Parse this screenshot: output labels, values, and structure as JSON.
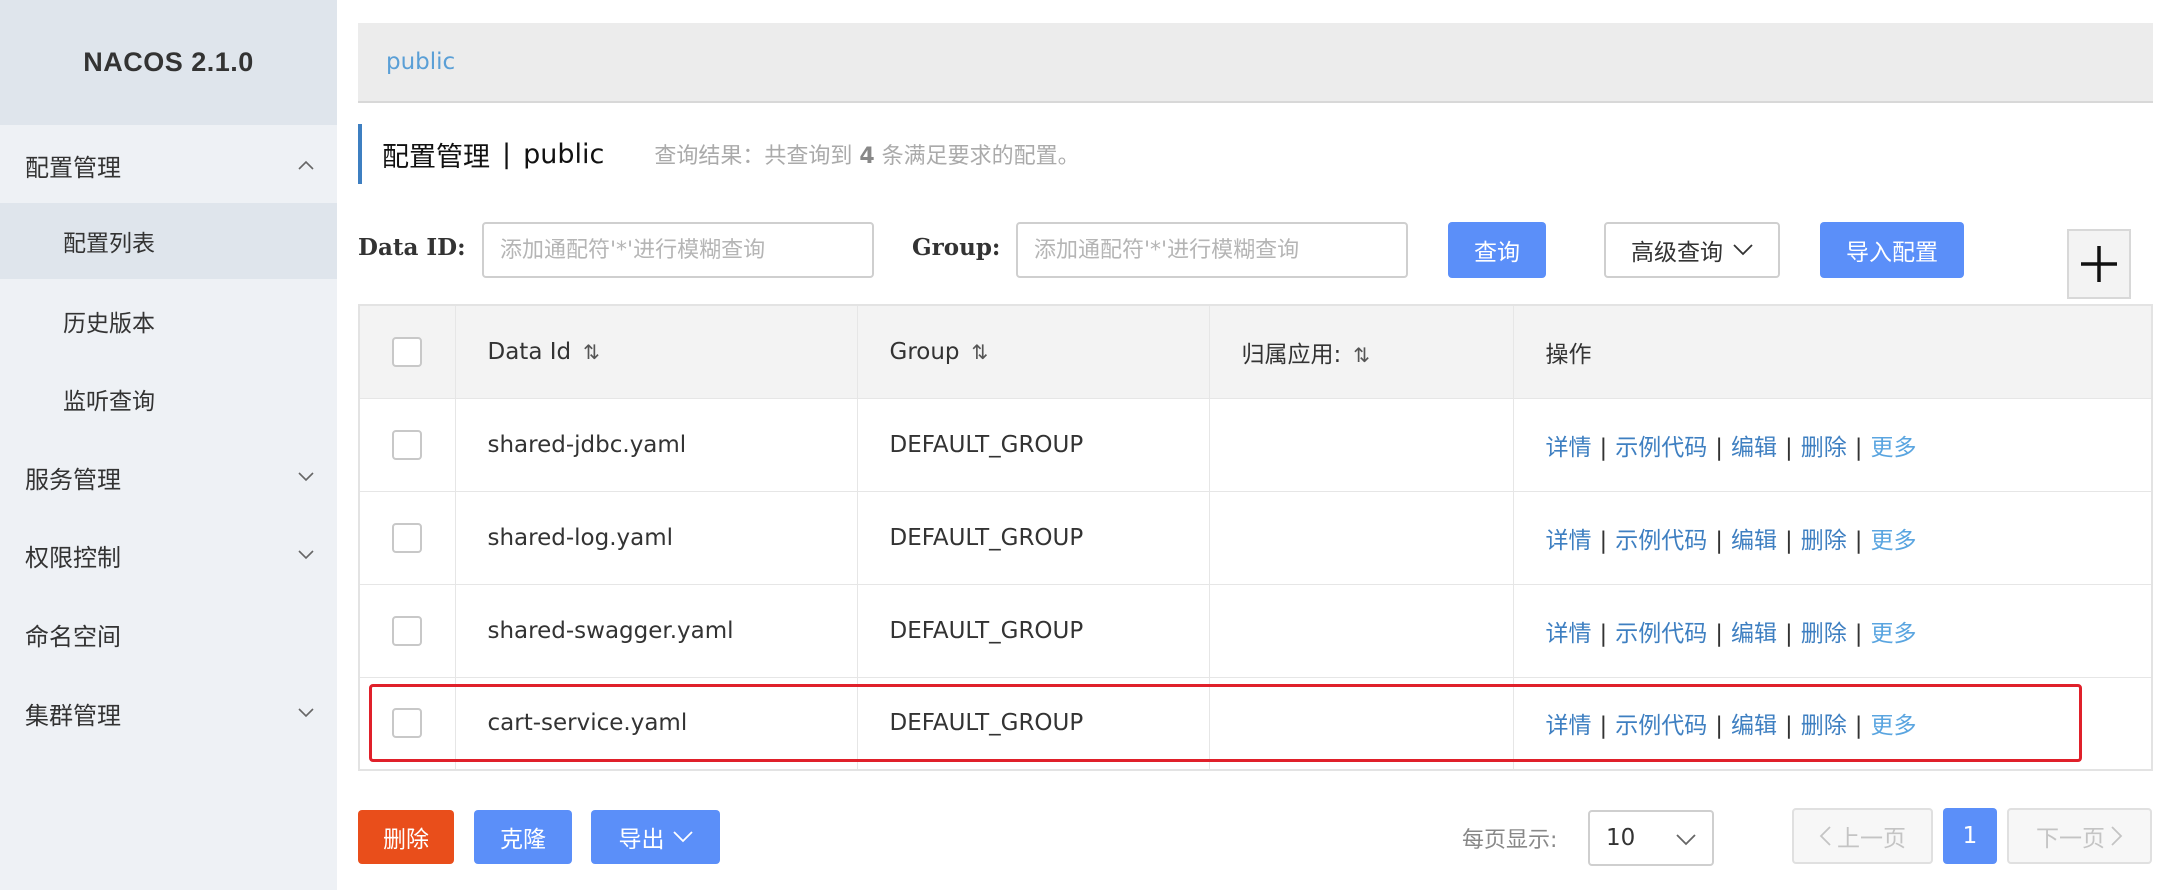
{
  "sidebar": {
    "brand": "NACOS 2.1.0",
    "config_mgmt": "配置管理",
    "sub_items": [
      "配置列表",
      "历史版本",
      "监听查询"
    ],
    "service_mgmt": "服务管理",
    "permission": "权限控制",
    "namespace": "命名空间",
    "cluster_mgmt": "集群管理"
  },
  "breadcrumb": {
    "namespace": "public"
  },
  "title": {
    "main": "配置管理",
    "separator": "|",
    "namespace": "public",
    "result_prefix": "查询结果：共查询到 ",
    "result_count": "4",
    "result_suffix": " 条满足要求的配置。"
  },
  "search": {
    "data_id_label": "Data ID:",
    "data_id_placeholder": "添加通配符'*'进行模糊查询",
    "group_label": "Group:",
    "group_placeholder": "添加通配符'*'进行模糊查询",
    "query_button": "查询",
    "advanced_button": "高级查询",
    "import_button": "导入配置"
  },
  "table": {
    "headers": {
      "data_id": "Data Id",
      "group": "Group",
      "app": "归属应用:",
      "ops": "操作"
    },
    "ops": {
      "detail": "详情",
      "sample": "示例代码",
      "edit": "编辑",
      "delete": "删除",
      "more": "更多",
      "sep": "|"
    },
    "rows": [
      {
        "data_id": "shared-jdbc.yaml",
        "group": "DEFAULT_GROUP",
        "app": ""
      },
      {
        "data_id": "shared-log.yaml",
        "group": "DEFAULT_GROUP",
        "app": ""
      },
      {
        "data_id": "shared-swagger.yaml",
        "group": "DEFAULT_GROUP",
        "app": ""
      },
      {
        "data_id": "cart-service.yaml",
        "group": "DEFAULT_GROUP",
        "app": ""
      }
    ]
  },
  "footer": {
    "delete_button": "删除",
    "clone_button": "克隆",
    "export_button": "导出",
    "per_page_label": "每页显示:",
    "per_page_value": "10",
    "prev_button": "上一页",
    "current_page": "1",
    "next_button": "下一页"
  },
  "colors": {
    "primary": "#5b8ff9",
    "danger": "#e94e1b",
    "highlight": "#e0202a"
  }
}
